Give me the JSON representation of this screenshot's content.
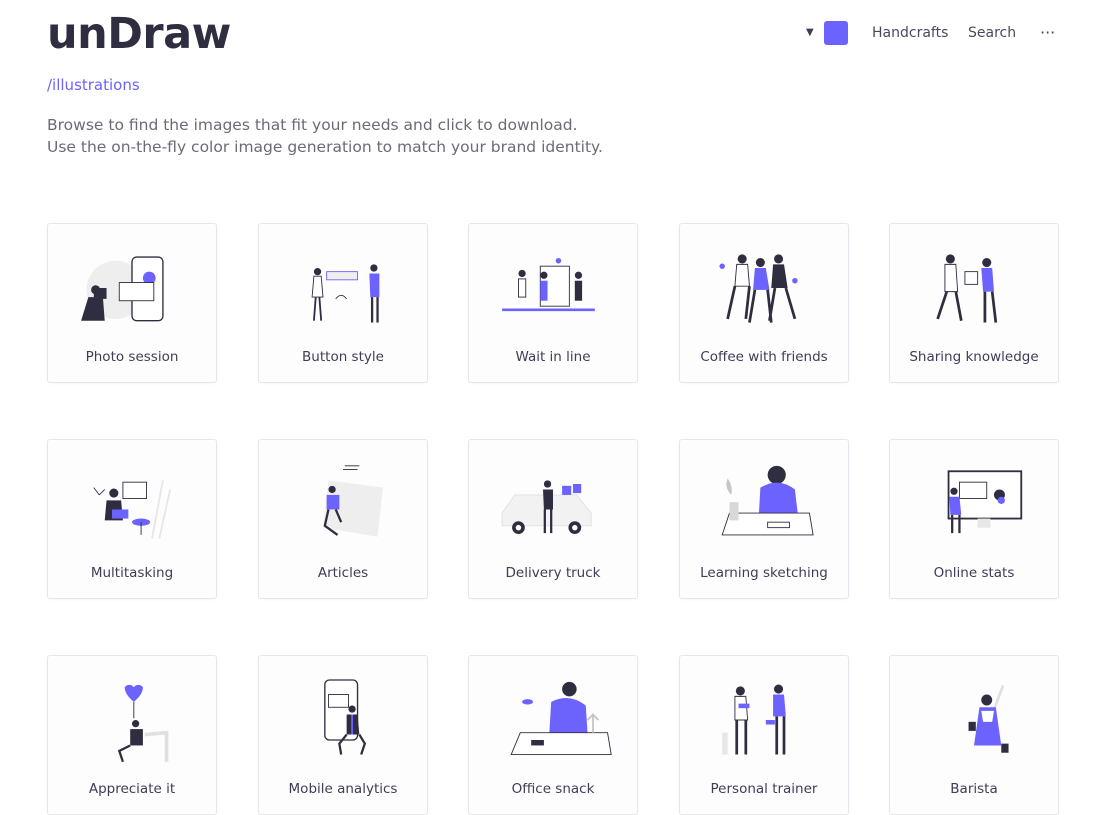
{
  "brand": {
    "logo": "unDraw",
    "subpath": "/illustrations"
  },
  "intro": "Browse to find the images that fit your needs and click to download. Use the on-the-fly color image generation to match your brand identity.",
  "nav": {
    "color_picker_icon": "caret-down-icon",
    "accent_color": "#6c63ff",
    "links": [
      "Handcrafts",
      "Search"
    ],
    "more_icon": "ellipsis-icon",
    "more_glyph": "···"
  },
  "colors": {
    "accent": "#6c63ff",
    "ink": "#2f2e41",
    "muted": "#e6e6ec"
  },
  "illustrations": [
    {
      "title": "Photo session"
    },
    {
      "title": "Button style"
    },
    {
      "title": "Wait in line"
    },
    {
      "title": "Coffee with friends"
    },
    {
      "title": "Sharing knowledge"
    },
    {
      "title": "Multitasking"
    },
    {
      "title": "Articles"
    },
    {
      "title": "Delivery truck"
    },
    {
      "title": "Learning sketching"
    },
    {
      "title": "Online stats"
    },
    {
      "title": "Appreciate it"
    },
    {
      "title": "Mobile analytics"
    },
    {
      "title": "Office snack"
    },
    {
      "title": "Personal trainer"
    },
    {
      "title": "Barista"
    }
  ]
}
